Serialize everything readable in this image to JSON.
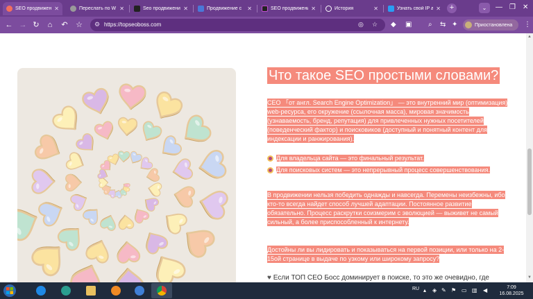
{
  "browser": {
    "tabs": [
      {
        "label": "SEO продвижение",
        "active": true,
        "favicon_color": "#f36f5e"
      },
      {
        "label": "Переслать по W",
        "active": false,
        "favicon_color": "#9a9a9a"
      },
      {
        "label": "Seo продвижени",
        "active": false,
        "favicon_color": "#222222"
      },
      {
        "label": "Продвижение с",
        "active": false,
        "favicon_color": "#4a78d8"
      },
      {
        "label": "SEO продвижени",
        "active": false,
        "favicon_color": "#222222"
      },
      {
        "label": "История",
        "active": false,
        "favicon_color": "#ffffff"
      },
      {
        "label": "Узнать свой IP а",
        "active": false,
        "favicon_color": "#2a9df4"
      }
    ],
    "new_tab_label": "+",
    "address": "https://topseoboss.com",
    "profile_label": "Приостановлена",
    "accent_color": "#7c4c9e"
  },
  "article": {
    "title": "Что такое SEO простыми словами?",
    "p1": "СЕО 「от англ. Search Engine Optimization」 — это внутренний мир (оптимизация) web-ресурса, его окружение (ссылочная масса), мировая значимость (узнаваемость, бренд, репутация) для привлеченных нужных посетителей (поведенческий фактор) и поисковиков (доступный и понятный контент для индексации и ранжирования).",
    "bullets": [
      "Для владельца сайта — это финальный результат.",
      "Для поисковых систем — это непрерывный процесс совершенствования."
    ],
    "p2": "В продвижении нельзя победить однажды и навсегда. Перемены неизбежны, ибо кто-то всегда найдет способ лучшей адаптации. Постоянное развитие обязательно. Процесс раскрутки соизмерим с эволюцией — выживет не самый сильный, а более приспособленный к интернету.",
    "p3": "Достойны ли вы лидировать и показываться на первой позиции, или только на 2-15ой странице в выдаче по узкому или широкому запросу?",
    "p4": "Если ТОП СЕО Босс доминирует в поиске, то это же очевидно, где",
    "highlight_color": "#f58a7c"
  },
  "taskbar": {
    "language": "RU",
    "time": "7:09",
    "date": "16.08.2025"
  }
}
